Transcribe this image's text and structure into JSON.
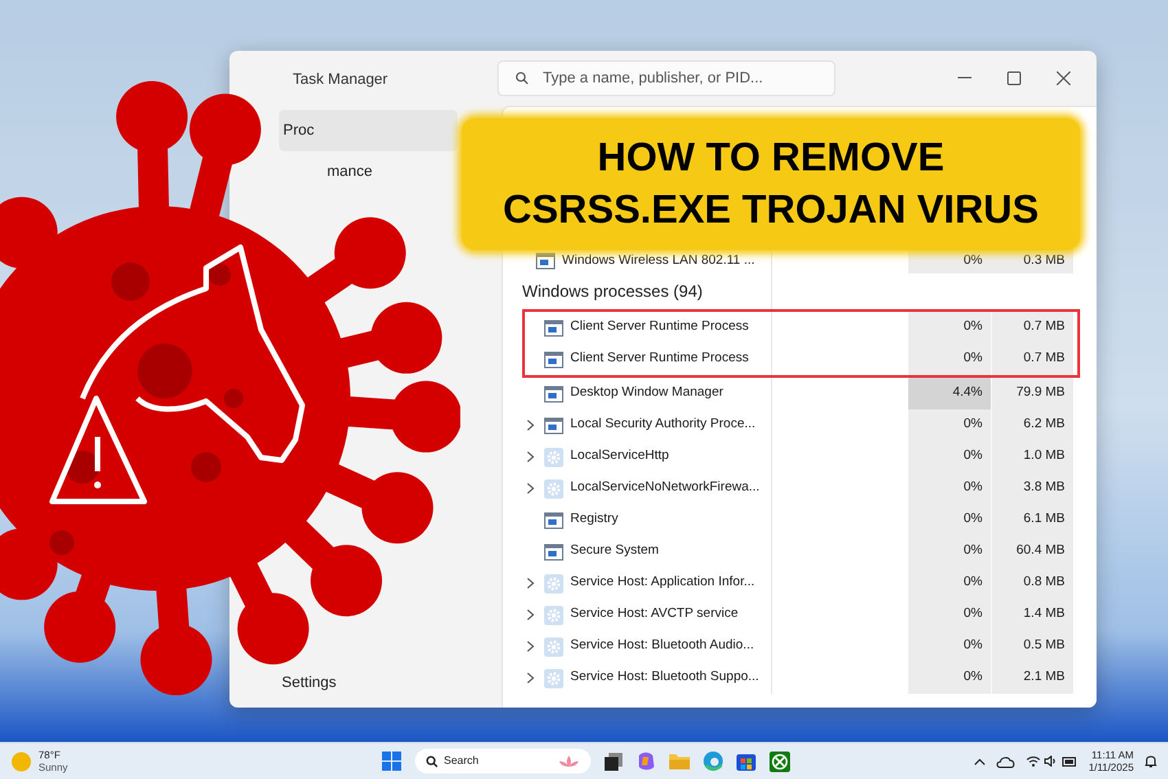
{
  "window": {
    "title": "Task Manager",
    "search": {
      "placeholder": "Type a name, publisher, or PID..."
    }
  },
  "sidebar": {
    "items": [
      {
        "label": "Proc",
        "selected": true
      },
      {
        "label": "mance",
        "selected": false
      }
    ],
    "footer": "Settings"
  },
  "banner": {
    "lines": [
      "HOW TO REMOVE",
      "CSRSS.EXE TROJAN VIRUS"
    ]
  },
  "top_rows": [
    {
      "name": "Windows Wireless LAN 802.11 ...",
      "cpu": "0%",
      "memory": "0.3 MB"
    }
  ],
  "group": {
    "title": "Windows processes (94)",
    "rows": [
      {
        "kind": "app",
        "expandable": false,
        "flagged": true,
        "busy": false,
        "name": "Client Server Runtime Process",
        "cpu": "0%",
        "memory": "0.7 MB"
      },
      {
        "kind": "app",
        "expandable": false,
        "flagged": true,
        "busy": false,
        "name": "Client Server Runtime Process",
        "cpu": "0%",
        "memory": "0.7 MB"
      },
      {
        "kind": "app",
        "expandable": false,
        "flagged": false,
        "busy": true,
        "name": "Desktop Window Manager",
        "cpu": "4.4%",
        "memory": "79.9 MB"
      },
      {
        "kind": "app",
        "expandable": true,
        "flagged": false,
        "busy": false,
        "name": "Local Security Authority Proce...",
        "cpu": "0%",
        "memory": "6.2 MB"
      },
      {
        "kind": "service",
        "expandable": true,
        "flagged": false,
        "busy": false,
        "name": "LocalServiceHttp",
        "cpu": "0%",
        "memory": "1.0 MB"
      },
      {
        "kind": "service",
        "expandable": true,
        "flagged": false,
        "busy": false,
        "name": "LocalServiceNoNetworkFirewa...",
        "cpu": "0%",
        "memory": "3.8 MB"
      },
      {
        "kind": "app",
        "expandable": false,
        "flagged": false,
        "busy": false,
        "name": "Registry",
        "cpu": "0%",
        "memory": "6.1 MB"
      },
      {
        "kind": "app",
        "expandable": false,
        "flagged": false,
        "busy": false,
        "name": "Secure System",
        "cpu": "0%",
        "memory": "60.4 MB"
      },
      {
        "kind": "service",
        "expandable": true,
        "flagged": false,
        "busy": false,
        "name": "Service Host: Application Infor...",
        "cpu": "0%",
        "memory": "0.8 MB"
      },
      {
        "kind": "service",
        "expandable": true,
        "flagged": false,
        "busy": false,
        "name": "Service Host: AVCTP service",
        "cpu": "0%",
        "memory": "1.4 MB"
      },
      {
        "kind": "service",
        "expandable": true,
        "flagged": false,
        "busy": false,
        "name": "Service Host: Bluetooth Audio...",
        "cpu": "0%",
        "memory": "0.5 MB"
      },
      {
        "kind": "service",
        "expandable": true,
        "flagged": false,
        "busy": false,
        "name": "Service Host: Bluetooth Suppo...",
        "cpu": "0%",
        "memory": "2.1 MB"
      }
    ]
  },
  "taskbar": {
    "weather": {
      "temp": "78°F",
      "condition": "Sunny"
    },
    "search": "Search",
    "time": "11:11 AM",
    "date": "1/11/2025"
  }
}
